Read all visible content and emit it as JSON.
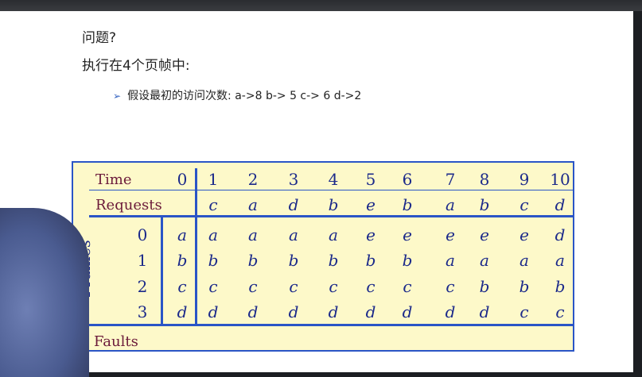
{
  "slide": {
    "question": "问题?",
    "exec_line": "执行在4个页帧中:",
    "bullet": "假设最初的访问次数: a->8   b-> 5  c-> 6   d->2"
  },
  "table": {
    "labels": {
      "time": "Time",
      "requests": "Requests",
      "page_frames": "Page Frames",
      "faults": "Faults"
    },
    "times": [
      "0",
      "1",
      "2",
      "3",
      "4",
      "5",
      "6",
      "7",
      "8",
      "9",
      "10"
    ],
    "requests": [
      "c",
      "a",
      "d",
      "b",
      "e",
      "b",
      "a",
      "b",
      "c",
      "d"
    ],
    "frame_indices": [
      "0",
      "1",
      "2",
      "3"
    ],
    "frames": [
      [
        "a",
        "a",
        "a",
        "a",
        "a",
        "e",
        "e",
        "e",
        "e",
        "e",
        "d"
      ],
      [
        "b",
        "b",
        "b",
        "b",
        "b",
        "b",
        "b",
        "a",
        "a",
        "a",
        "a"
      ],
      [
        "c",
        "c",
        "c",
        "c",
        "c",
        "c",
        "c",
        "c",
        "b",
        "b",
        "b"
      ],
      [
        "d",
        "d",
        "d",
        "d",
        "d",
        "d",
        "d",
        "d",
        "d",
        "c",
        "c"
      ]
    ]
  },
  "colors": {
    "table_bg": "#fdf9c9",
    "rule": "#2a55c6",
    "label_text": "#6b1a3a",
    "cell_text": "#1c2a8a"
  }
}
